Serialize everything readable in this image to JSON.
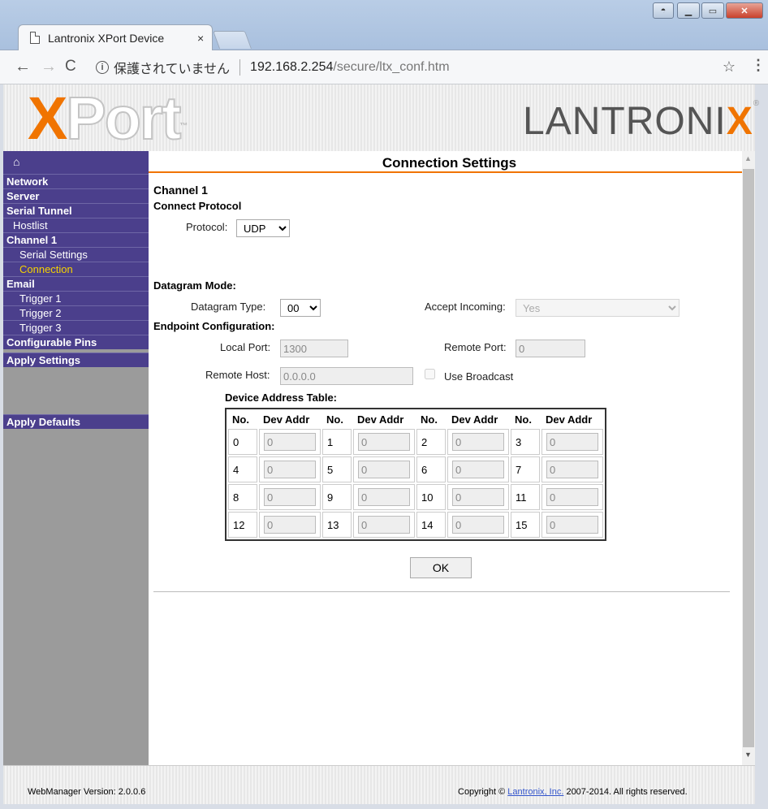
{
  "browser": {
    "tab_title": "Lantronix XPort Device",
    "tab_close": "×",
    "security_label": "保護されていません",
    "url_host": "192.168.2.254",
    "url_path": "/secure/ltx_conf.htm",
    "back": "←",
    "forward": "→",
    "reload": "C",
    "info": "i",
    "star": "☆",
    "menu": "⋮"
  },
  "banner": {
    "logo_x": "X",
    "logo_port": "Port",
    "logo_tm": "™",
    "brand_main": "LANTRONI",
    "brand_x": "X",
    "brand_reg": "®"
  },
  "sidebar": {
    "home_icon": "⌂",
    "items": {
      "network": "Network",
      "server": "Server",
      "serial_tunnel": "Serial Tunnel",
      "hostlist": "Hostlist",
      "channel1": "Channel 1",
      "serial_settings": "Serial Settings",
      "connection": "Connection",
      "email": "Email",
      "trigger1": "Trigger 1",
      "trigger2": "Trigger 2",
      "trigger3": "Trigger 3",
      "configurable_pins": "Configurable Pins",
      "apply_settings": "Apply Settings",
      "apply_defaults": "Apply Defaults"
    }
  },
  "content": {
    "title": "Connection Settings",
    "channel": "Channel 1",
    "connect_protocol_heading": "Connect Protocol",
    "protocol_label": "Protocol:",
    "protocol_value": "UDP",
    "datagram_mode_heading": "Datagram Mode:",
    "datagram_type_label": "Datagram Type:",
    "datagram_type_value": "00",
    "accept_incoming_label": "Accept Incoming:",
    "accept_incoming_value": "Yes",
    "endpoint_heading": "Endpoint Configuration:",
    "local_port_label": "Local Port:",
    "local_port_value": "1300",
    "remote_port_label": "Remote Port:",
    "remote_port_value": "0",
    "remote_host_label": "Remote Host:",
    "remote_host_value": "0.0.0.0",
    "use_broadcast_label": "Use Broadcast",
    "device_table_heading": "Device Address Table:",
    "table": {
      "headers": [
        "No.",
        "Dev Addr",
        "No.",
        "Dev Addr",
        "No.",
        "Dev Addr",
        "No.",
        "Dev Addr"
      ],
      "rows": [
        [
          {
            "no": "0",
            "addr": "0"
          },
          {
            "no": "1",
            "addr": "0"
          },
          {
            "no": "2",
            "addr": "0"
          },
          {
            "no": "3",
            "addr": "0"
          }
        ],
        [
          {
            "no": "4",
            "addr": "0"
          },
          {
            "no": "5",
            "addr": "0"
          },
          {
            "no": "6",
            "addr": "0"
          },
          {
            "no": "7",
            "addr": "0"
          }
        ],
        [
          {
            "no": "8",
            "addr": "0"
          },
          {
            "no": "9",
            "addr": "0"
          },
          {
            "no": "10",
            "addr": "0"
          },
          {
            "no": "11",
            "addr": "0"
          }
        ],
        [
          {
            "no": "12",
            "addr": "0"
          },
          {
            "no": "13",
            "addr": "0"
          },
          {
            "no": "14",
            "addr": "0"
          },
          {
            "no": "15",
            "addr": "0"
          }
        ]
      ]
    },
    "ok_label": "OK"
  },
  "footer": {
    "version": "WebManager Version: 2.0.0.6",
    "copy_prefix": "Copyright © ",
    "copy_link": "Lantronix, Inc.",
    "copy_suffix": " 2007-2014. All rights reserved."
  },
  "colors": {
    "accent_orange": "#f07400",
    "sidebar_purple": "#4b3f8c",
    "sidebar_active": "#f5d200",
    "sidebar_gray": "#9b9b9b"
  }
}
